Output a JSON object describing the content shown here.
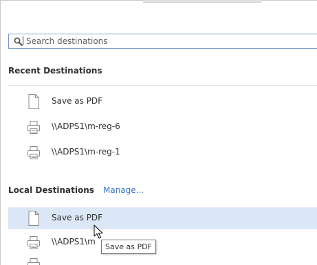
{
  "search": {
    "placeholder": "Search destinations"
  },
  "recent": {
    "heading": "Recent Destinations",
    "items": [
      {
        "label": "Save as PDF",
        "icon": "pdf-document-icon"
      },
      {
        "label": "\\\\ADPS1\\m-reg-6",
        "icon": "printer-icon"
      },
      {
        "label": "\\\\ADPS1\\m-reg-1",
        "icon": "printer-icon"
      }
    ]
  },
  "local": {
    "heading": "Local Destinations",
    "manage_label": "Manage...",
    "items": [
      {
        "label": "Save as PDF",
        "icon": "pdf-document-icon",
        "highlighted": true
      },
      {
        "label": "\\\\ADPS1\\m",
        "icon": "printer-icon"
      },
      {
        "label": "",
        "icon": "printer-icon"
      }
    ]
  },
  "tooltip": {
    "text": "Save as PDF"
  },
  "colors": {
    "accent": "#3b73cf",
    "highlight": "#dbe6f6",
    "search_border": "#7a9bd0"
  }
}
